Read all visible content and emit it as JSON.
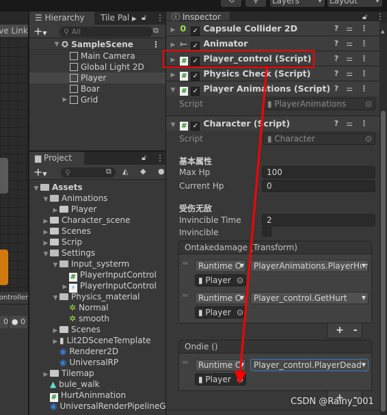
{
  "toolbar": {
    "layers": "Layers",
    "layout": "Layout",
    "history_icon": "history-icon",
    "search_icon": "search-icon"
  },
  "scene": {
    "link_label": "ve Link",
    "controller_label": "ontroller",
    "count_label": "0",
    "warning_count": "0"
  },
  "hierarchy": {
    "tab": "Hierarchy",
    "tab2": "Tile Pal",
    "search_placeholder": "All",
    "scene": "SampleScene",
    "items": [
      {
        "label": "Main Camera"
      },
      {
        "label": "Global Light 2D"
      },
      {
        "label": "Player",
        "selected": true
      },
      {
        "label": "Boar"
      },
      {
        "label": "Grid"
      }
    ]
  },
  "project": {
    "tab": "Project",
    "items": [
      {
        "label": "Assets",
        "depth": 0,
        "type": "folder-open",
        "arrow": "down"
      },
      {
        "label": "Animations",
        "depth": 1,
        "type": "folder-open",
        "arrow": "down"
      },
      {
        "label": "Player",
        "depth": 2,
        "type": "folder",
        "arrow": "right"
      },
      {
        "label": "Character_scene",
        "depth": 1,
        "type": "folder",
        "arrow": "right"
      },
      {
        "label": "Scenes",
        "depth": 1,
        "type": "folder",
        "arrow": "right"
      },
      {
        "label": "Scrip",
        "depth": 1,
        "type": "folder",
        "arrow": "right"
      },
      {
        "label": "Settings",
        "depth": 1,
        "type": "folder-open",
        "arrow": "down"
      },
      {
        "label": "Input_systerm",
        "depth": 2,
        "type": "folder-open",
        "arrow": "down"
      },
      {
        "label": "PlayerInputControl",
        "depth": 3,
        "type": "script",
        "arrow": ""
      },
      {
        "label": "PlayerInputControl",
        "depth": 3,
        "type": "input-actions",
        "arrow": "right"
      },
      {
        "label": "Physics_material",
        "depth": 2,
        "type": "folder-open",
        "arrow": "down"
      },
      {
        "label": "Normal",
        "depth": 3,
        "type": "physics-material",
        "arrow": ""
      },
      {
        "label": "smooth",
        "depth": 3,
        "type": "physics-material",
        "arrow": ""
      },
      {
        "label": "Scenes",
        "depth": 2,
        "type": "folder",
        "arrow": "right"
      },
      {
        "label": "Lit2DSceneTemplate",
        "depth": 2,
        "type": "scene-template",
        "arrow": "right"
      },
      {
        "label": "Renderer2D",
        "depth": 2,
        "type": "asset",
        "arrow": ""
      },
      {
        "label": "UniversalRP",
        "depth": 2,
        "type": "asset",
        "arrow": ""
      },
      {
        "label": "Tilemap",
        "depth": 1,
        "type": "folder",
        "arrow": "right"
      },
      {
        "label": "bule_walk",
        "depth": 1,
        "type": "animation",
        "arrow": ""
      },
      {
        "label": "HurtAninmation",
        "depth": 1,
        "type": "script",
        "arrow": ""
      },
      {
        "label": "UniversalRenderPipelineGl",
        "depth": 1,
        "type": "asset",
        "arrow": ""
      }
    ]
  },
  "inspector": {
    "tab": "Inspector",
    "components": [
      {
        "label": "Capsule Collider 2D",
        "expanded": false,
        "enabled": true,
        "icon": "capsule-collider-icon"
      },
      {
        "label": "Animator",
        "expanded": false,
        "enabled": true,
        "icon": "animator-icon"
      },
      {
        "label": "Player_control (Script)",
        "expanded": false,
        "enabled": true,
        "icon": "script-icon",
        "highlighted": true
      },
      {
        "label": "Physics Check (Script)",
        "expanded": false,
        "enabled": true,
        "icon": "script-icon"
      },
      {
        "label": "Player Animations (Script)",
        "expanded": true,
        "enabled": true,
        "icon": "script-icon"
      }
    ],
    "script_label": "Script",
    "player_animations_script": "PlayerAnimations",
    "character": {
      "label": "Character (Script)",
      "script": "Character",
      "section1": "基本属性",
      "max_hp_label": "Max Hp",
      "max_hp": "100",
      "current_hp_label": "Current Hp",
      "current_hp": "0",
      "section2": "受伤无敌",
      "inv_time_label": "Invincible Time",
      "inv_time": "2",
      "invincible_label": "Invincible",
      "invincible": false,
      "events": [
        {
          "title": "Ontakedamage (Transform)",
          "listeners": [
            {
              "mode": "Runtime O",
              "function": "PlayerAnimations.PlayerHur",
              "object": "Player"
            },
            {
              "mode": "Runtime O",
              "function": "Player_control.GetHurt",
              "object": "Player"
            }
          ]
        },
        {
          "title": "Ondie ()",
          "listeners": [
            {
              "mode": "Runtime O",
              "function": "Player_control.PlayerDead",
              "object": "Player",
              "focused": true
            }
          ]
        }
      ]
    }
  },
  "watermark": "CSDN @Rainy_001",
  "colors": {
    "annotation": "#ff0000",
    "focus": "#3a79bb",
    "script_icon": "#1f8a1f"
  }
}
